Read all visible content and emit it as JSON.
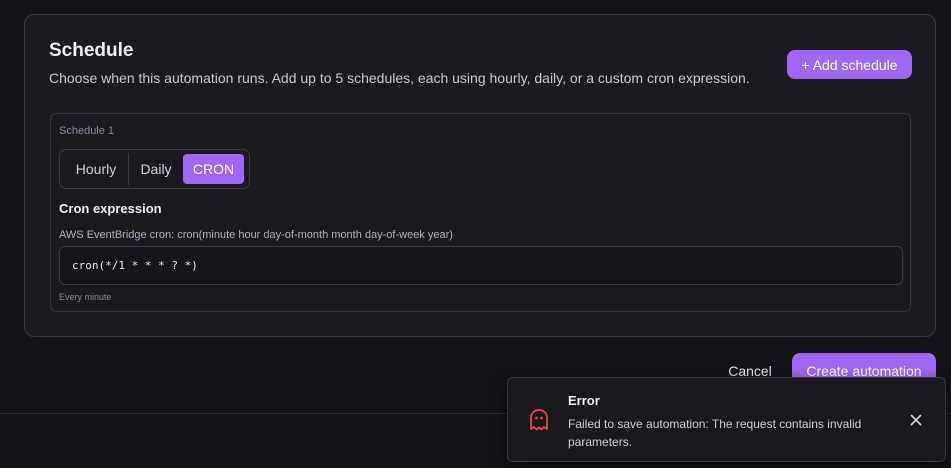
{
  "schedule": {
    "title": "Schedule",
    "description": "Choose when this automation runs. Add up to 5 schedules, each using hourly, daily, or a custom cron expression.",
    "add_button": "+ Add schedule",
    "items": [
      {
        "label": "Schedule 1",
        "modes": [
          "Hourly",
          "Daily",
          "CRON"
        ],
        "selected_mode": "CRON",
        "cron_heading": "Cron expression",
        "cron_hint": "AWS EventBridge cron: cron(minute hour day-of-month month day-of-week year)",
        "cron_value": "cron(*/1 * * * ? *)",
        "cron_caption": "Every minute"
      }
    ]
  },
  "actions": {
    "cancel": "Cancel",
    "create": "Create automation"
  },
  "toast": {
    "title": "Error",
    "message": "Failed to save automation: The request contains invalid parameters.",
    "icon": "ghost-icon",
    "close_icon": "close-icon"
  },
  "colors": {
    "accent": "#a066f5",
    "background": "#141217",
    "card": "#1c1a20",
    "error": "#e5484d"
  }
}
